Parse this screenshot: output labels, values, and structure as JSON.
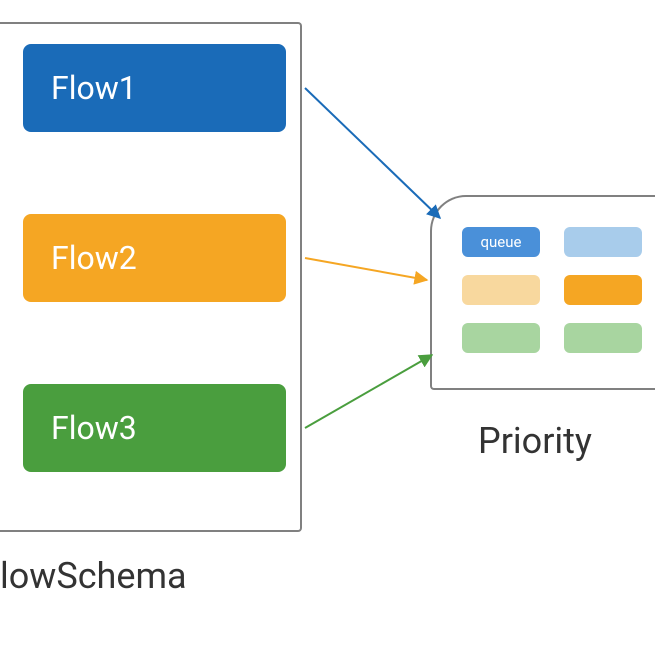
{
  "flowSchema": {
    "label": "lowSchema",
    "flows": [
      {
        "id": "flow1",
        "label": "Flow1",
        "color": "#1a6bb8"
      },
      {
        "id": "flow2",
        "label": "Flow2",
        "color": "#f5a623"
      },
      {
        "id": "flow3",
        "label": "Flow3",
        "color": "#4a9e3e"
      }
    ]
  },
  "priority": {
    "label": "Priority",
    "queueLabel": "queue",
    "rows": [
      [
        {
          "color": "#4a90d9",
          "labelKey": "queueLabel"
        },
        {
          "color": "#a8cceb"
        }
      ],
      [
        {
          "color": "#f8d89e"
        },
        {
          "color": "#f5a623"
        }
      ],
      [
        {
          "color": "#a8d5a0"
        },
        {
          "color": "#a8d5a0"
        }
      ]
    ]
  },
  "arrows": [
    {
      "from": "flow1",
      "color": "#1a6bb8"
    },
    {
      "from": "flow2",
      "color": "#f5a623"
    },
    {
      "from": "flow3",
      "color": "#4a9e3e"
    }
  ]
}
